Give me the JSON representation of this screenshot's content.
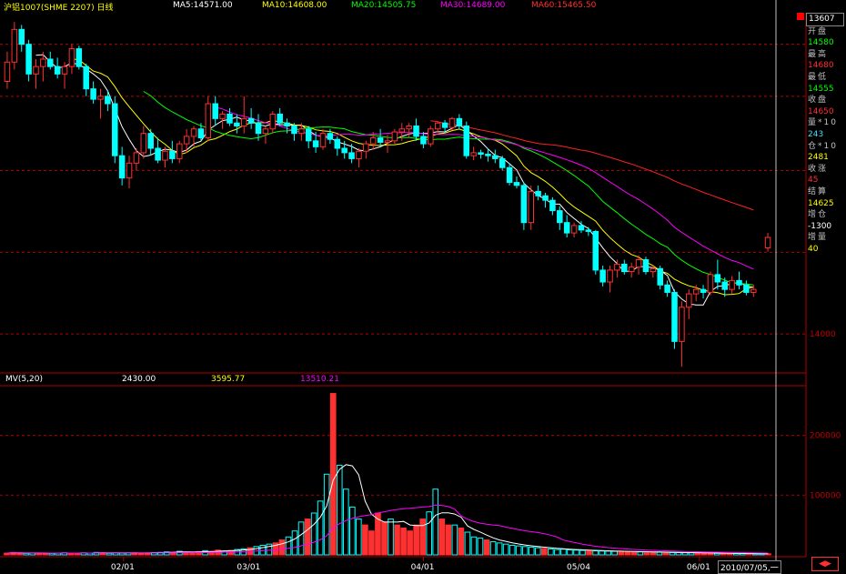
{
  "header": {
    "title": "沪铝1007(SHME 2207) 日线",
    "ma5": "MA5:14571.00",
    "ma10": "MA10:14608.00",
    "ma20": "MA20:14505.75",
    "ma30": "MA30:14689.00",
    "ma60": "MA60:15465.50"
  },
  "volume_header": {
    "title": "MV(5,20)",
    "v1": "2430.00",
    "v2": "3595.77",
    "v3": "13510.21"
  },
  "info_panel": [
    {
      "label": "",
      "value": "13607",
      "color": "#ffffff"
    },
    {
      "label": "开盘",
      "value": "14580",
      "color": "#00ff00"
    },
    {
      "label": "最高",
      "value": "14680",
      "color": "#ff3030"
    },
    {
      "label": "最低",
      "value": "14555",
      "color": "#00ff00"
    },
    {
      "label": "收盘",
      "value": "14650",
      "color": "#ff3030"
    },
    {
      "label": "量*10",
      "value": "243",
      "color": "#40e0ff"
    },
    {
      "label": "仓*10",
      "value": "2481",
      "color": "#ffff00"
    },
    {
      "label": "收涨",
      "value": "45",
      "color": "#ff3030"
    },
    {
      "label": "结算",
      "value": "14625",
      "color": "#ffff00"
    },
    {
      "label": "增仓",
      "value": "-1300",
      "color": "#ffffff"
    },
    {
      "label": "增量",
      "value": "40",
      "color": "#ffff00"
    }
  ],
  "status_date": "2010/07/05,一",
  "colors": {
    "up": "#ff3030",
    "down": "#00ffff",
    "ma5": "#ffffff",
    "ma10": "#ffff00",
    "ma20": "#00ff00",
    "ma30": "#ff00ff",
    "ma60": "#ff2020",
    "grid": "#b00000"
  },
  "chart_data": [
    {
      "type": "candlestick",
      "title": "沪铝1007(SHME 2207) 日线",
      "x_ticks": [
        "02/01",
        "03/01",
        "04/01",
        "05/04",
        "06/01"
      ],
      "y_ticks": [
        14000
      ],
      "ylim": [
        13750,
        16150
      ],
      "candles": [
        [
          15700,
          15900,
          15650,
          15830
        ],
        [
          15830,
          16100,
          15780,
          16050
        ],
        [
          16050,
          16080,
          15900,
          15950
        ],
        [
          15950,
          15980,
          15700,
          15750
        ],
        [
          15750,
          15850,
          15650,
          15800
        ],
        [
          15800,
          15900,
          15700,
          15850
        ],
        [
          15850,
          15900,
          15780,
          15800
        ],
        [
          15800,
          15860,
          15720,
          15750
        ],
        [
          15750,
          15830,
          15650,
          15800
        ],
        [
          15800,
          15950,
          15750,
          15920
        ],
        [
          15920,
          15940,
          15780,
          15800
        ],
        [
          15800,
          15820,
          15600,
          15650
        ],
        [
          15650,
          15700,
          15550,
          15580
        ],
        [
          15580,
          15650,
          15450,
          15600
        ],
        [
          15600,
          15640,
          15500,
          15550
        ],
        [
          15550,
          15600,
          15150,
          15200
        ],
        [
          15200,
          15260,
          15000,
          15050
        ],
        [
          15050,
          15200,
          14980,
          15150
        ],
        [
          15150,
          15250,
          15100,
          15220
        ],
        [
          15220,
          15400,
          15180,
          15350
        ],
        [
          15350,
          15380,
          15200,
          15250
        ],
        [
          15250,
          15320,
          15150,
          15170
        ],
        [
          15170,
          15260,
          15120,
          15230
        ],
        [
          15230,
          15300,
          15150,
          15180
        ],
        [
          15180,
          15300,
          15150,
          15280
        ],
        [
          15280,
          15380,
          15220,
          15330
        ],
        [
          15330,
          15400,
          15260,
          15380
        ],
        [
          15380,
          15420,
          15300,
          15320
        ],
        [
          15320,
          15600,
          15300,
          15550
        ],
        [
          15550,
          15600,
          15400,
          15450
        ],
        [
          15450,
          15500,
          15380,
          15480
        ],
        [
          15480,
          15520,
          15400,
          15420
        ],
        [
          15420,
          15480,
          15350,
          15400
        ],
        [
          15400,
          15600,
          15350,
          15450
        ],
        [
          15450,
          15520,
          15380,
          15420
        ],
        [
          15420,
          15480,
          15300,
          15350
        ],
        [
          15350,
          15400,
          15280,
          15380
        ],
        [
          15380,
          15500,
          15350,
          15480
        ],
        [
          15480,
          15520,
          15400,
          15420
        ],
        [
          15420,
          15450,
          15350,
          15400
        ],
        [
          15400,
          15420,
          15300,
          15350
        ],
        [
          15350,
          15420,
          15300,
          15380
        ],
        [
          15380,
          15400,
          15250,
          15300
        ],
        [
          15300,
          15360,
          15220,
          15260
        ],
        [
          15260,
          15380,
          15240,
          15350
        ],
        [
          15350,
          15380,
          15280,
          15310
        ],
        [
          15310,
          15330,
          15200,
          15250
        ],
        [
          15250,
          15300,
          15180,
          15220
        ],
        [
          15220,
          15280,
          15150,
          15180
        ],
        [
          15180,
          15250,
          15120,
          15230
        ],
        [
          15230,
          15300,
          15180,
          15280
        ],
        [
          15280,
          15360,
          15240,
          15320
        ],
        [
          15320,
          15380,
          15260,
          15290
        ],
        [
          15290,
          15340,
          15220,
          15300
        ],
        [
          15300,
          15380,
          15280,
          15360
        ],
        [
          15360,
          15420,
          15300,
          15380
        ],
        [
          15380,
          15420,
          15320,
          15400
        ],
        [
          15400,
          15450,
          15300,
          15330
        ],
        [
          15330,
          15360,
          15250,
          15280
        ],
        [
          15280,
          15400,
          15260,
          15380
        ],
        [
          15380,
          15430,
          15360,
          15420
        ],
        [
          15420,
          15440,
          15350,
          15390
        ],
        [
          15390,
          15460,
          15370,
          15450
        ],
        [
          15450,
          15480,
          15380,
          15400
        ],
        [
          15400,
          15430,
          15180,
          15200
        ],
        [
          15200,
          15260,
          15170,
          15220
        ],
        [
          15220,
          15240,
          15180,
          15210
        ],
        [
          15210,
          15250,
          15160,
          15200
        ],
        [
          15200,
          15240,
          15150,
          15180
        ],
        [
          15180,
          15200,
          15100,
          15120
        ],
        [
          15120,
          15150,
          15000,
          15020
        ],
        [
          15020,
          15060,
          14980,
          15000
        ],
        [
          15000,
          15020,
          14700,
          14750
        ],
        [
          14750,
          15000,
          14700,
          14960
        ],
        [
          14960,
          15000,
          14900,
          14930
        ],
        [
          14930,
          14950,
          14850,
          14900
        ],
        [
          14900,
          14920,
          14800,
          14830
        ],
        [
          14830,
          14860,
          14700,
          14750
        ],
        [
          14750,
          14800,
          14650,
          14680
        ],
        [
          14680,
          14750,
          14650,
          14730
        ],
        [
          14730,
          14760,
          14680,
          14700
        ],
        [
          14700,
          14720,
          14660,
          14690
        ],
        [
          14690,
          14700,
          14400,
          14430
        ],
        [
          14430,
          14460,
          14320,
          14350
        ],
        [
          14350,
          14460,
          14280,
          14430
        ],
        [
          14430,
          14500,
          14380,
          14470
        ],
        [
          14470,
          14500,
          14400,
          14420
        ],
        [
          14420,
          14480,
          14380,
          14450
        ],
        [
          14450,
          14530,
          14400,
          14500
        ],
        [
          14500,
          14520,
          14400,
          14420
        ],
        [
          14420,
          14460,
          14380,
          14440
        ],
        [
          14440,
          14460,
          14300,
          14330
        ],
        [
          14330,
          14360,
          14250,
          14280
        ],
        [
          14280,
          14300,
          13900,
          13950
        ],
        [
          13950,
          14220,
          13780,
          14180
        ],
        [
          14180,
          14300,
          14100,
          14270
        ],
        [
          14270,
          14330,
          14220,
          14300
        ],
        [
          14300,
          14330,
          14240,
          14280
        ],
        [
          14280,
          14420,
          14260,
          14400
        ],
        [
          14400,
          14500,
          14300,
          14350
        ],
        [
          14350,
          14380,
          14250,
          14300
        ],
        [
          14300,
          14390,
          14270,
          14360
        ],
        [
          14360,
          14420,
          14300,
          14330
        ],
        [
          14330,
          14360,
          14260,
          14280
        ],
        [
          14280,
          14330,
          14250,
          14300
        ]
      ],
      "last_bar": {
        "open": 14580,
        "high": 14680,
        "low": 14555,
        "close": 14650
      }
    },
    {
      "type": "bar",
      "title": "MV(5,20)",
      "y_ticks": [
        100000,
        200000
      ],
      "ylim": [
        0,
        280000
      ],
      "volumes": [
        3000,
        4000,
        3500,
        2500,
        3000,
        2800,
        3200,
        2600,
        3100,
        3500,
        2700,
        3000,
        3300,
        2900,
        4100,
        3800,
        2600,
        3200,
        2900,
        3400,
        3600,
        3000,
        3300,
        3800,
        4200,
        5000,
        4600,
        6000,
        4300,
        3900,
        5500,
        7000,
        6200,
        8000,
        6500,
        7500,
        9000,
        10000,
        12000,
        14000,
        16000,
        18000,
        20000,
        25000,
        30000,
        40000,
        55000,
        60000,
        70000,
        90000,
        135000,
        270000,
        150000,
        110000,
        80000,
        60000,
        50000,
        40000,
        70000,
        55000,
        60000,
        50000,
        45000,
        40000,
        50000,
        60000,
        72000,
        110000,
        60000,
        50000,
        50000,
        45000,
        38000,
        30000,
        28000,
        25000,
        22000,
        20000,
        18000,
        16000,
        15000,
        14000,
        13000,
        12000,
        11000,
        10000,
        9000,
        9500,
        8500,
        8000,
        7500,
        7000,
        6800,
        6500,
        6200,
        6000,
        5800,
        5500,
        5200,
        5000,
        4800,
        4600,
        4400,
        4200,
        4000,
        3800,
        3600,
        3400,
        3200,
        3000,
        2800,
        2600,
        2500,
        2400,
        2300,
        2200,
        2100,
        2000,
        1900,
        1800
      ]
    }
  ]
}
